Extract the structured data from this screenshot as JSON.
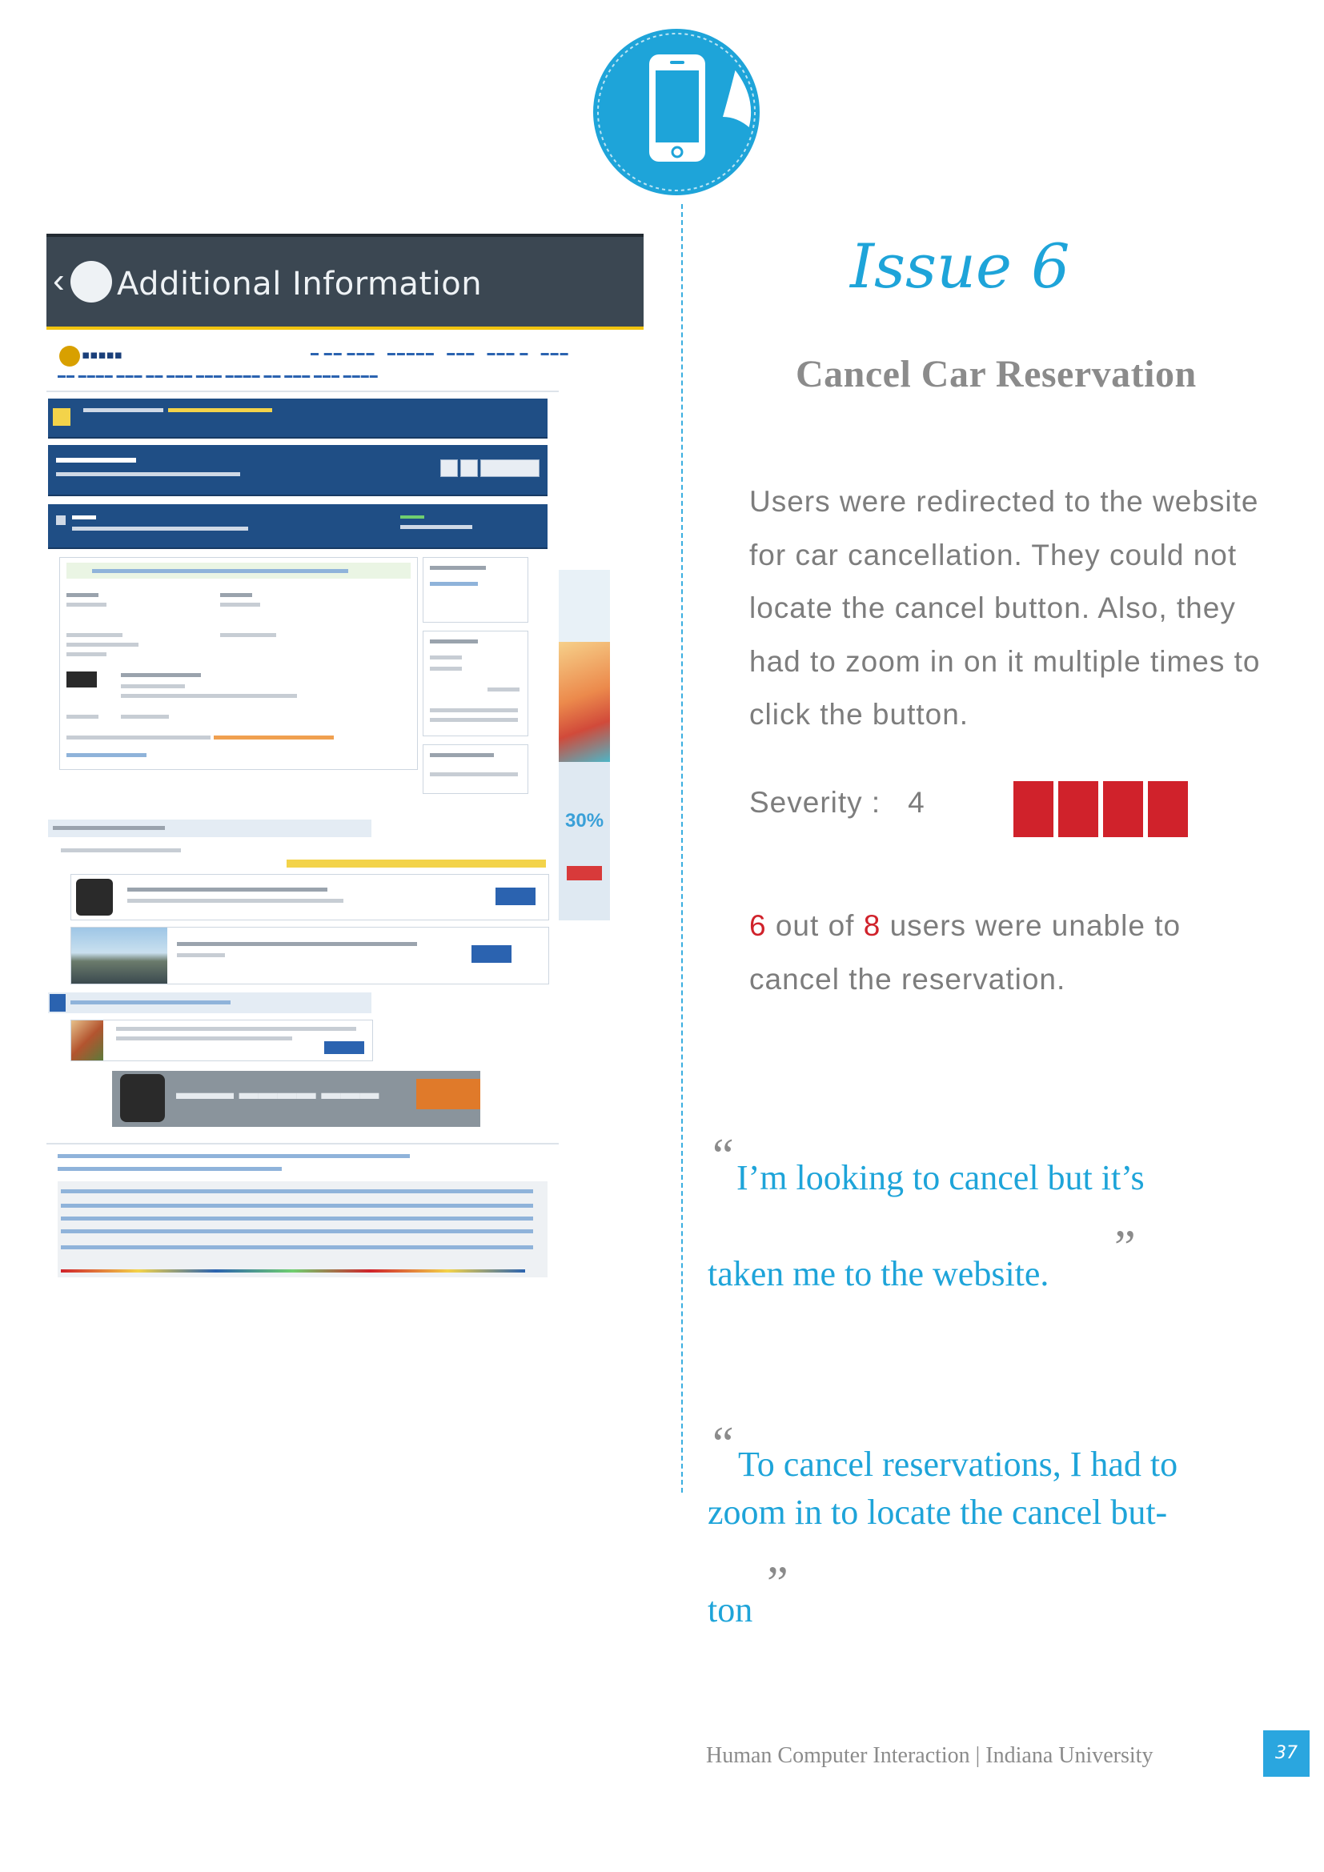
{
  "screenshot": {
    "header_title": "Additional Information"
  },
  "issue_title": "Issue 6",
  "subtitle": "Cancel Car Reservation",
  "description": "Users were redirected to the website for car cancellation. They could not locate the cancel button. Also, they had to zoom in on it multiple times to click the button.",
  "severity": {
    "label": "Severity :",
    "value": "4",
    "level": 4,
    "color": "#d0222b"
  },
  "stat": {
    "count": "6",
    "out_of_label": "out of",
    "total": "8",
    "rest": "users were unable to cancel the reservation."
  },
  "quotes": [
    {
      "line1": "I’m looking to cancel but it’s",
      "line2": "taken me to the  website."
    },
    {
      "line1": "To cancel reservations, I had to",
      "line2": "zoom in to locate the cancel but-",
      "line3": "ton"
    }
  ],
  "footer": "Human Computer Interaction | Indiana University",
  "page_number": "37",
  "colors": {
    "accent": "#1ea4d9",
    "severity_red": "#d0222b"
  }
}
